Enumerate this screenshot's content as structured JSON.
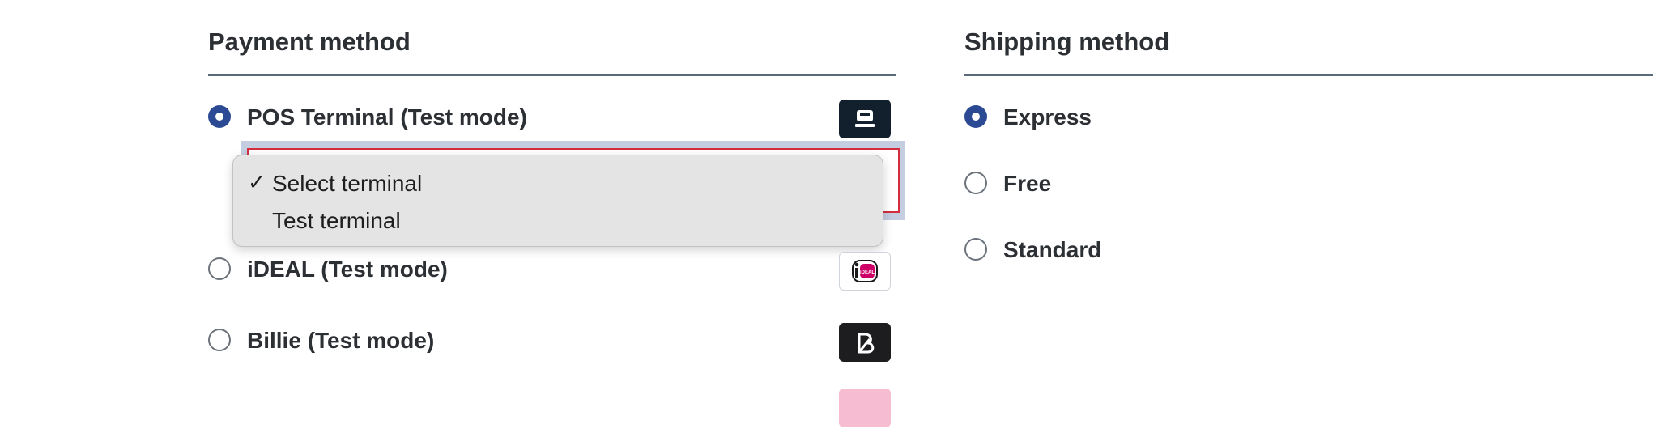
{
  "payment": {
    "title": "Payment method",
    "options": [
      {
        "label": "POS Terminal (Test mode)",
        "selected": true,
        "logo": "pos-terminal-icon"
      },
      {
        "label": "iDEAL (Test mode)",
        "selected": false,
        "logo": "ideal-logo"
      },
      {
        "label": "Billie (Test mode)",
        "selected": false,
        "logo": "billie-logo"
      }
    ],
    "terminal_select": {
      "options": [
        {
          "label": "Select terminal",
          "checked": true
        },
        {
          "label": "Test terminal",
          "checked": false
        }
      ],
      "check_glyph": "✓"
    },
    "ideal_logo_text": "iDEAL"
  },
  "shipping": {
    "title": "Shipping method",
    "options": [
      {
        "label": "Express",
        "selected": true
      },
      {
        "label": "Free",
        "selected": false
      },
      {
        "label": "Standard",
        "selected": false
      }
    ]
  },
  "colors": {
    "radio_selected": "#2b4a93",
    "select_error_border": "#d42d3e",
    "ideal_pink": "#cc0066"
  }
}
